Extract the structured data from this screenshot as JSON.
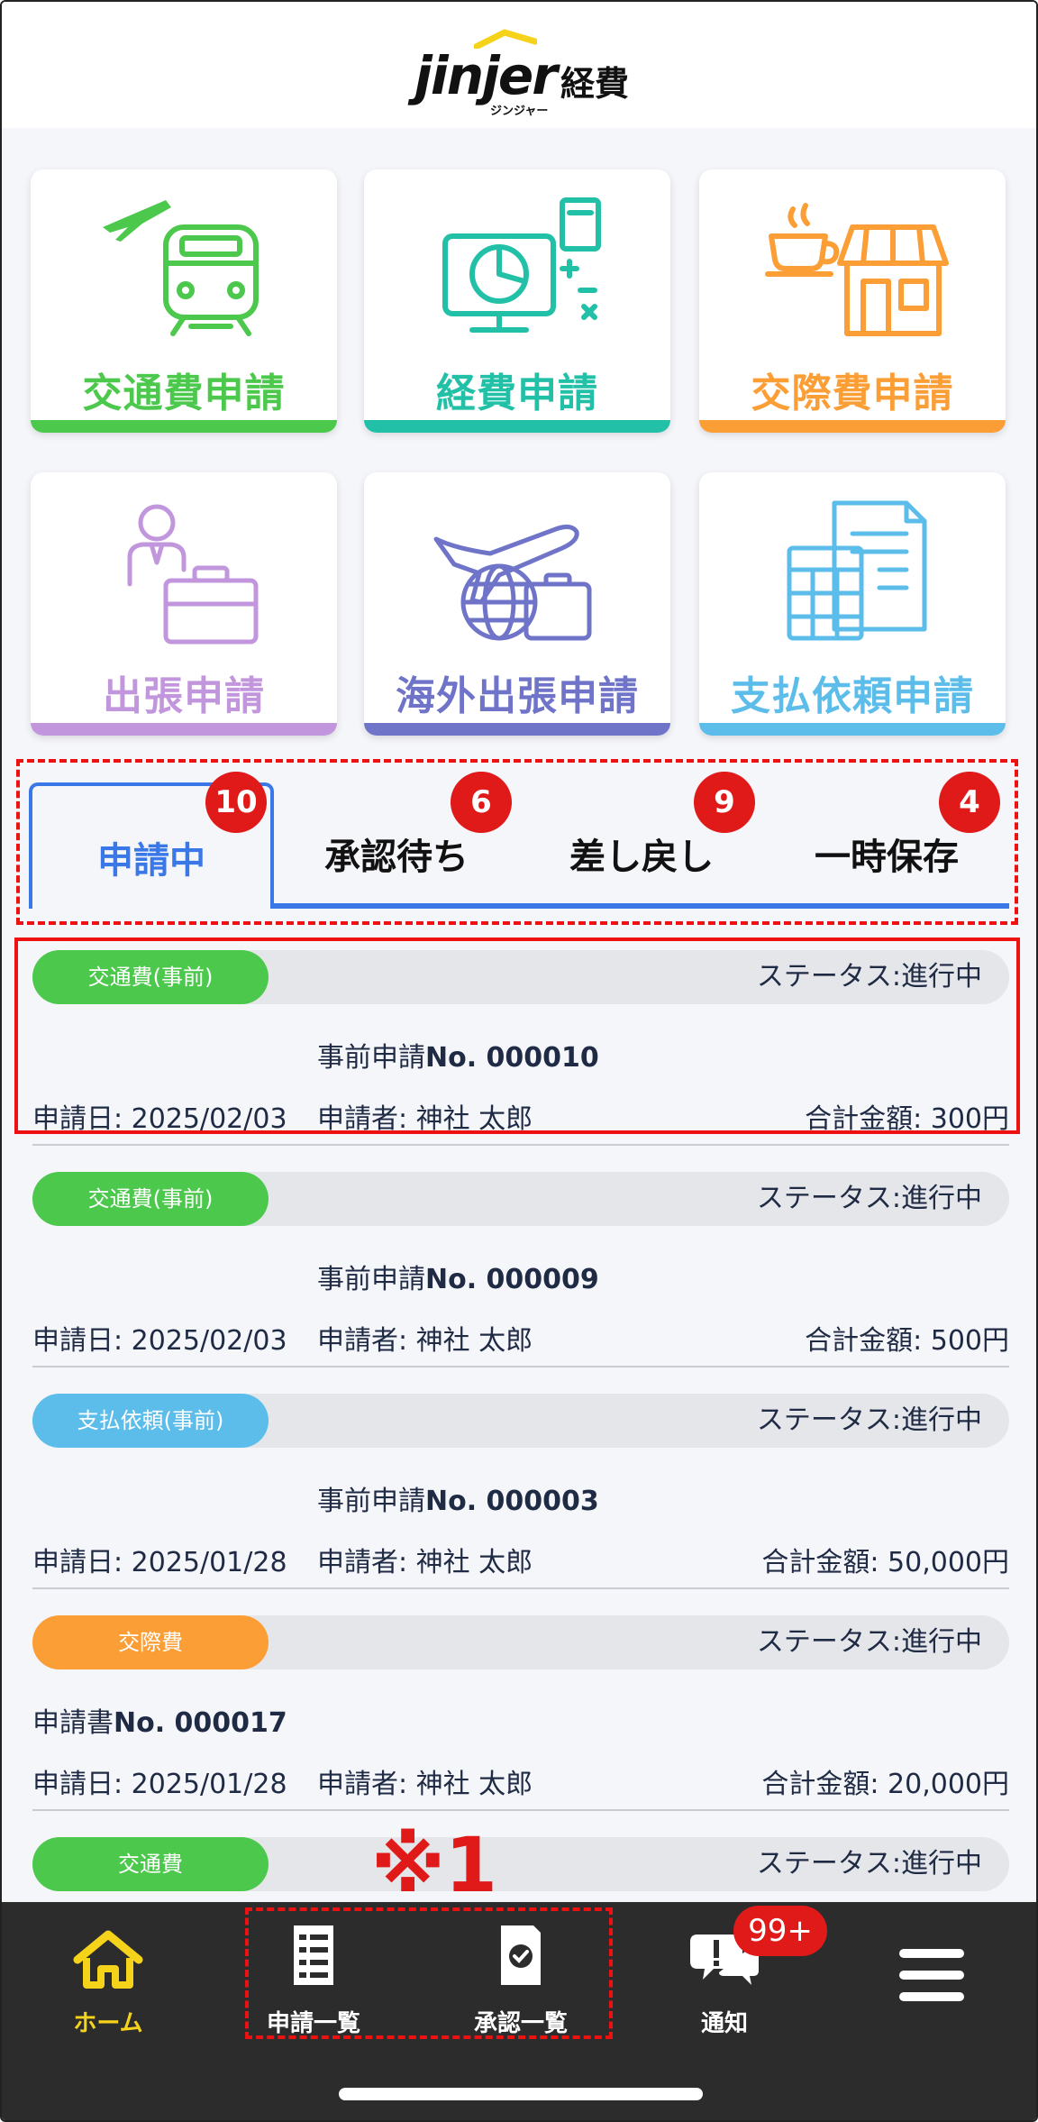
{
  "header": {
    "logo_main": "jinjer",
    "logo_keihi": "経費",
    "logo_sub": "ジンジャー"
  },
  "tiles": [
    {
      "label": "交通費申請",
      "color": "#4cc94c",
      "icon": "train-plane-icon"
    },
    {
      "label": "経費申請",
      "color": "#22c1a7",
      "icon": "monitor-chart-icon"
    },
    {
      "label": "交際費申請",
      "color": "#fb9e36",
      "icon": "cafe-shop-icon"
    },
    {
      "label": "出張申請",
      "color": "#c296dc",
      "icon": "business-trip-icon"
    },
    {
      "label": "海外出張申請",
      "color": "#6f74c9",
      "icon": "plane-globe-icon"
    },
    {
      "label": "支払依頼申請",
      "color": "#5cbdea",
      "icon": "building-document-icon"
    }
  ],
  "tabs": [
    {
      "label": "申請中",
      "badge": "10"
    },
    {
      "label": "承認待ち",
      "badge": "6"
    },
    {
      "label": "差し戻し",
      "badge": "9"
    },
    {
      "label": "一時保存",
      "badge": "4"
    }
  ],
  "cards": [
    {
      "tag": "交通費(事前)",
      "tag_color": "#4cc94c",
      "status": "ステータス:進行中",
      "number_prefix": "事前申請",
      "number": "No. 000010",
      "date": "申請日: 2025/02/03",
      "applicant": "申請者: 神社 太郎",
      "amount": "合計金額: 300円"
    },
    {
      "tag": "交通費(事前)",
      "tag_color": "#4cc94c",
      "status": "ステータス:進行中",
      "number_prefix": "事前申請",
      "number": "No. 000009",
      "date": "申請日: 2025/02/03",
      "applicant": "申請者: 神社 太郎",
      "amount": "合計金額: 500円"
    },
    {
      "tag": "支払依頼(事前)",
      "tag_color": "#5cbdea",
      "status": "ステータス:進行中",
      "number_prefix": "事前申請",
      "number": "No. 000003",
      "date": "申請日: 2025/01/28",
      "applicant": "申請者: 神社 太郎",
      "amount": "合計金額: 50,000円"
    },
    {
      "tag": "交際費",
      "tag_color": "#fb9e36",
      "status": "ステータス:進行中",
      "number_prefix": "申請書",
      "number": "No. 000017",
      "date": "申請日: 2025/01/28",
      "applicant": "申請者: 神社 太郎",
      "amount": "合計金額: 20,000円"
    },
    {
      "tag": "交通費",
      "tag_color": "#4cc94c",
      "status": "ステータス:進行中"
    }
  ],
  "note": "※1",
  "nav": {
    "home": "ホーム",
    "applications": "申請一覧",
    "approvals": "承認一覧",
    "notifications": "通知",
    "notif_badge": "99+",
    "active_color": "#f6d31b"
  }
}
